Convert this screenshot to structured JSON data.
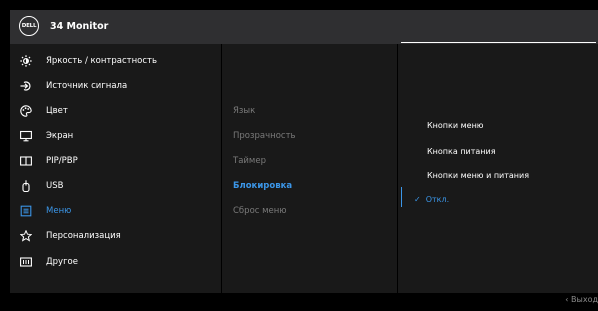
{
  "header": {
    "logo": "DELL",
    "title": "34 Monitor"
  },
  "menu": {
    "items": [
      {
        "label": "Яркость / контрастность",
        "icon": "brightness-icon"
      },
      {
        "label": "Источник сигнала",
        "icon": "input-source-icon"
      },
      {
        "label": "Цвет",
        "icon": "color-palette-icon"
      },
      {
        "label": "Экран",
        "icon": "display-icon"
      },
      {
        "label": "PIP/PBP",
        "icon": "pip-pbp-icon"
      },
      {
        "label": "USB",
        "icon": "usb-icon"
      },
      {
        "label": "Меню",
        "icon": "menu-icon"
      },
      {
        "label": "Персонализация",
        "icon": "star-icon"
      },
      {
        "label": "Другое",
        "icon": "other-icon"
      }
    ],
    "active_index": 6
  },
  "submenu": {
    "items": [
      "Язык",
      "Прозрачность",
      "Таймер",
      "Блокировка",
      "Сброс меню"
    ],
    "active_index": 3
  },
  "options": {
    "items": [
      "Кнопки меню",
      "Кнопка питания",
      "Кнопки меню и питания",
      "Откл."
    ],
    "selected_index": 3,
    "check": "✓"
  },
  "footer": {
    "exit_label": "Выход",
    "exit_icon": "chevron-left-icon"
  },
  "colors": {
    "accent": "#3b96e8",
    "panel": "#191919",
    "header": "#2f2f31",
    "background": "#000000"
  }
}
